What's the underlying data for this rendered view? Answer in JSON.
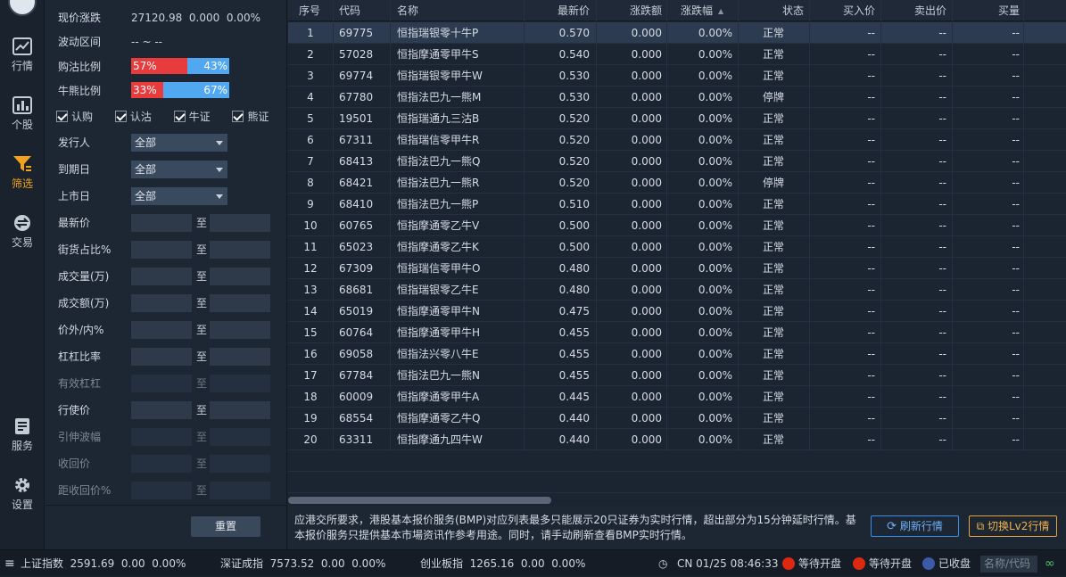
{
  "nav": {
    "items": [
      {
        "label": "行情",
        "icon": "chart-line-icon"
      },
      {
        "label": "个股",
        "icon": "bar-chart-icon"
      },
      {
        "label": "筛选",
        "icon": "filter-icon",
        "active": true
      },
      {
        "label": "交易",
        "icon": "trade-icon"
      },
      {
        "label": "服务",
        "icon": "document-icon"
      },
      {
        "label": "设置",
        "icon": "gear-icon"
      }
    ]
  },
  "filter": {
    "current_label": "现价涨跌",
    "current_value": "27120.98  0.000  0.00%",
    "range_label": "波动区间",
    "range_value": "-- ~ --",
    "callput_label": "购沽比例",
    "callput_a": "57%",
    "callput_b": "43%",
    "callput_a_frac": 0.57,
    "bullbear_label": "牛熊比例",
    "bullbear_a": "33%",
    "bullbear_b": "67%",
    "bullbear_a_frac": 0.33,
    "checks": [
      "认购",
      "认沽",
      "牛证",
      "熊证"
    ],
    "selects": [
      {
        "label": "发行人",
        "value": "全部"
      },
      {
        "label": "到期日",
        "value": "全部"
      },
      {
        "label": "上市日",
        "value": "全部"
      }
    ],
    "ranges": [
      {
        "label": "最新价",
        "dim": false
      },
      {
        "label": "街货占比%",
        "dim": false
      },
      {
        "label": "成交量(万)",
        "dim": false
      },
      {
        "label": "成交额(万)",
        "dim": false
      },
      {
        "label": "价外/内%",
        "dim": false
      },
      {
        "label": "杠杠比率",
        "dim": false
      },
      {
        "label": "有效杠杠",
        "dim": true
      },
      {
        "label": "行使价",
        "dim": false
      },
      {
        "label": "引伸波幅",
        "dim": true
      },
      {
        "label": "收回价",
        "dim": true
      },
      {
        "label": "距收回价%",
        "dim": true
      }
    ],
    "to_label": "至",
    "reset_label": "重置",
    "accent_call": "#e83c3c",
    "accent_put": "#52a8f0"
  },
  "table": {
    "headers": [
      "序号",
      "代码",
      "名称",
      "最新价",
      "涨跌额",
      "涨跌幅",
      "状态",
      "买入价",
      "卖出价",
      "买量"
    ],
    "sort_icon": "sort-updown-icon",
    "rows": [
      [
        "1",
        "69775",
        "恒指瑞银零十牛P",
        "0.570",
        "0.000",
        "0.00%",
        "正常",
        "--",
        "--",
        "--"
      ],
      [
        "2",
        "57028",
        "恒指摩通零甲牛S",
        "0.540",
        "0.000",
        "0.00%",
        "正常",
        "--",
        "--",
        "--"
      ],
      [
        "3",
        "69774",
        "恒指瑞银零甲牛W",
        "0.530",
        "0.000",
        "0.00%",
        "正常",
        "--",
        "--",
        "--"
      ],
      [
        "4",
        "67780",
        "恒指法巴九一熊M",
        "0.530",
        "0.000",
        "0.00%",
        "停牌",
        "--",
        "--",
        "--"
      ],
      [
        "5",
        "19501",
        "恒指瑞通九三沽B",
        "0.520",
        "0.000",
        "0.00%",
        "正常",
        "--",
        "--",
        "--"
      ],
      [
        "6",
        "67311",
        "恒指瑞信零甲牛R",
        "0.520",
        "0.000",
        "0.00%",
        "正常",
        "--",
        "--",
        "--"
      ],
      [
        "7",
        "68413",
        "恒指法巴九一熊Q",
        "0.520",
        "0.000",
        "0.00%",
        "正常",
        "--",
        "--",
        "--"
      ],
      [
        "8",
        "68421",
        "恒指法巴九一熊R",
        "0.520",
        "0.000",
        "0.00%",
        "停牌",
        "--",
        "--",
        "--"
      ],
      [
        "9",
        "68410",
        "恒指法巴九一熊P",
        "0.510",
        "0.000",
        "0.00%",
        "正常",
        "--",
        "--",
        "--"
      ],
      [
        "10",
        "60765",
        "恒指摩通零乙牛V",
        "0.500",
        "0.000",
        "0.00%",
        "正常",
        "--",
        "--",
        "--"
      ],
      [
        "11",
        "65023",
        "恒指摩通零乙牛K",
        "0.500",
        "0.000",
        "0.00%",
        "正常",
        "--",
        "--",
        "--"
      ],
      [
        "12",
        "67309",
        "恒指瑞信零甲牛O",
        "0.480",
        "0.000",
        "0.00%",
        "正常",
        "--",
        "--",
        "--"
      ],
      [
        "13",
        "68681",
        "恒指瑞银零乙牛E",
        "0.480",
        "0.000",
        "0.00%",
        "正常",
        "--",
        "--",
        "--"
      ],
      [
        "14",
        "65019",
        "恒指摩通零甲牛N",
        "0.475",
        "0.000",
        "0.00%",
        "正常",
        "--",
        "--",
        "--"
      ],
      [
        "15",
        "60764",
        "恒指摩通零甲牛H",
        "0.455",
        "0.000",
        "0.00%",
        "正常",
        "--",
        "--",
        "--"
      ],
      [
        "16",
        "69058",
        "恒指法兴零八牛E",
        "0.455",
        "0.000",
        "0.00%",
        "正常",
        "--",
        "--",
        "--"
      ],
      [
        "17",
        "67784",
        "恒指法巴九一熊N",
        "0.455",
        "0.000",
        "0.00%",
        "正常",
        "--",
        "--",
        "--"
      ],
      [
        "18",
        "60009",
        "恒指摩通零甲牛A",
        "0.445",
        "0.000",
        "0.00%",
        "正常",
        "--",
        "--",
        "--"
      ],
      [
        "19",
        "68554",
        "恒指摩通零乙牛Q",
        "0.440",
        "0.000",
        "0.00%",
        "正常",
        "--",
        "--",
        "--"
      ],
      [
        "20",
        "63311",
        "恒指摩通九四牛W",
        "0.440",
        "0.000",
        "0.00%",
        "正常",
        "--",
        "--",
        "--"
      ]
    ]
  },
  "notice": {
    "text": "应港交所要求，港股基本报价服务(BMP)对应列表最多只能展示20只证券为实时行情，超出部分为15分钟延时行情。基本报价服务只提供基本市場资讯作参考用途。同时，请手动刷新查看BMP实时行情。",
    "refresh_label": "刷新行情",
    "lv2_label": "切换Lv2行情"
  },
  "status": {
    "sh": "上证指数  2591.69  0.00  0.00%",
    "sz": "深证成指  7573.52  0.00  0.00%",
    "cy": "创业板指  1265.16  0.00  0.00%",
    "time": "CN 01/25 08:46:33",
    "hk": "等待开盘",
    "cn": "等待开盘",
    "us": "已收盘",
    "search_placeholder": "名称/代码"
  }
}
